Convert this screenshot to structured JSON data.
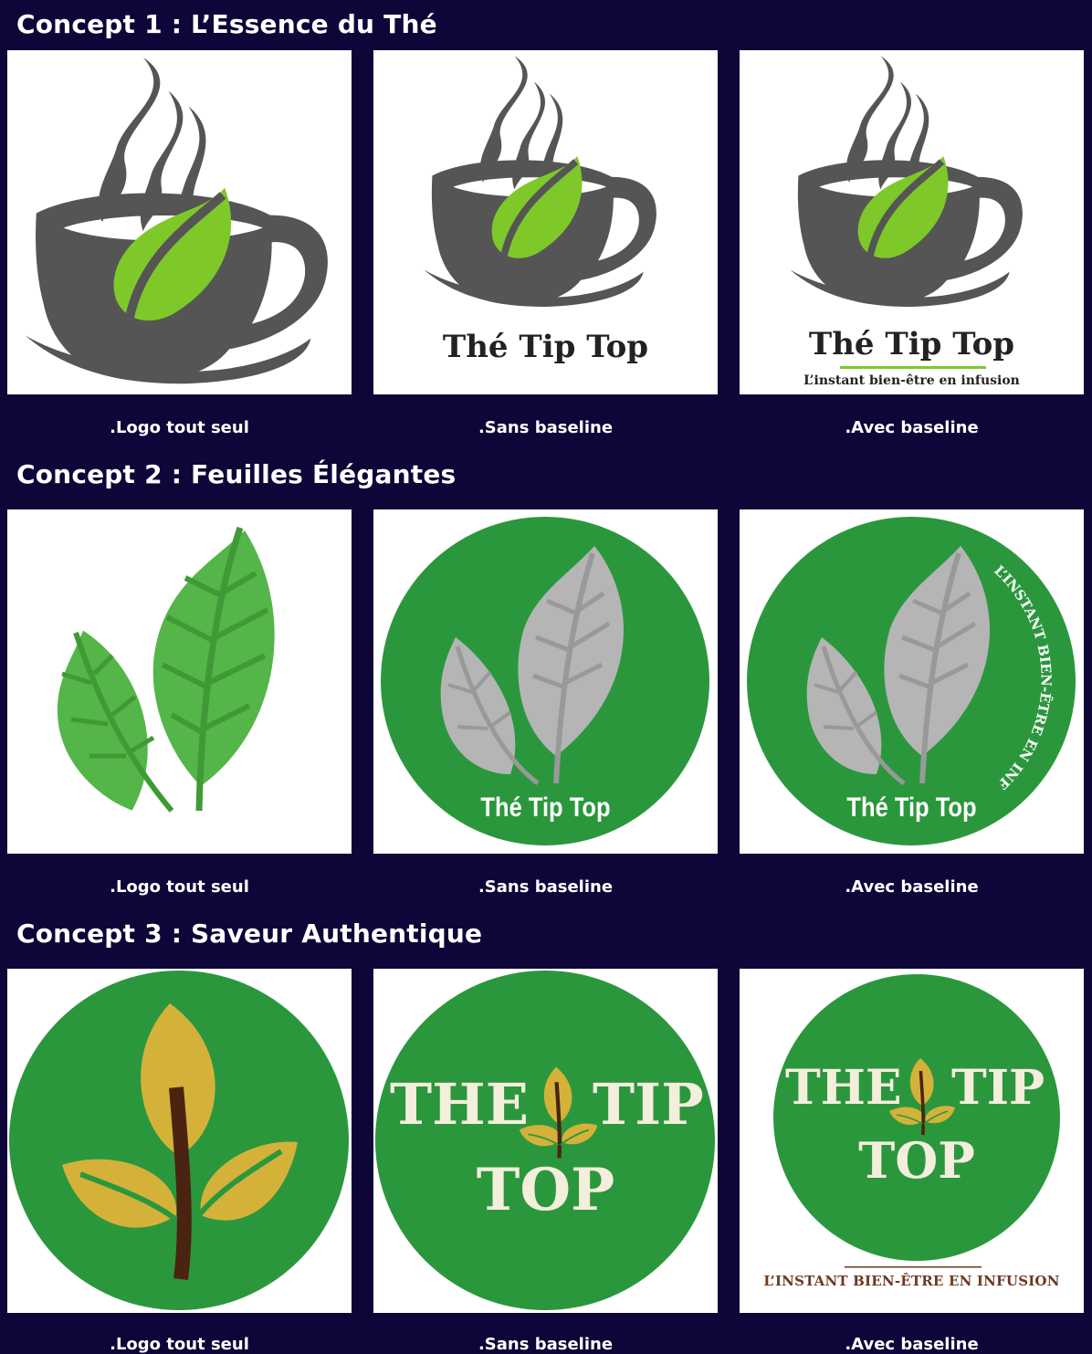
{
  "concepts": [
    {
      "title": "Concept 1 : L’Essence du Thé",
      "captions": [
        ".Logo tout seul",
        ".Sans baseline",
        ".Avec baseline"
      ],
      "wordmark": "Thé Tip Top",
      "baseline": "L’instant bien-être en infusion"
    },
    {
      "title": "Concept 2 : Feuilles Élégantes",
      "captions": [
        ".Logo tout seul",
        ".Sans baseline",
        ".Avec baseline"
      ],
      "wordmark": "Thé Tip Top",
      "baseline": "L’INSTANT BIEN-ÊTRE EN INFUSION"
    },
    {
      "title": "Concept 3 : Saveur Authentique",
      "captions": [
        ".Logo tout seul",
        ".Sans baseline",
        ".Avec baseline"
      ],
      "wordmark_line1_left": "THE",
      "wordmark_line1_right": "TIP",
      "wordmark_line2": "TOP",
      "baseline": "L’INSTANT BIEN-ÊTRE EN INFUSION"
    }
  ],
  "colors": {
    "background": "#0e0538",
    "cup_gray": "#555555",
    "leaf_lime": "#7ec82a",
    "leaf_green": "#54b548",
    "badge_green": "#2b973d",
    "leaf_silver": "#b5b5b5",
    "leaf_gold": "#d4b23a",
    "stem_brown": "#4a2410",
    "baseline_brown": "#6b3a1e"
  },
  "icons": [
    "tea-cup-icon",
    "steam-icon",
    "leaf-icon",
    "sprout-icon"
  ]
}
